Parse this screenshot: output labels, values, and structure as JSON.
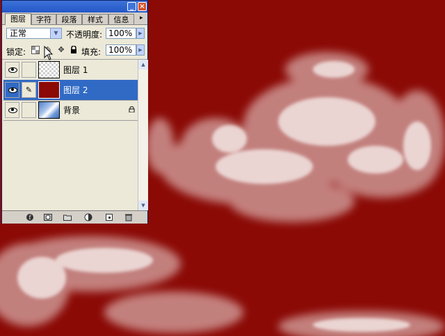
{
  "palette": {
    "tabs": [
      "图层",
      "字符",
      "段落",
      "样式",
      "信息"
    ],
    "window_min_label": "_",
    "window_close_label": "×",
    "tab_menu_glyph": "▸",
    "blend_mode": "正常",
    "opacity_label": "不透明度:",
    "opacity_value": "100%",
    "lock_label": "锁定:",
    "fill_label": "填充:",
    "fill_value": "100%"
  },
  "layers": [
    {
      "name": "图层 1",
      "selected": false,
      "thumb": "transparent"
    },
    {
      "name": "图层 2",
      "selected": true,
      "thumb": "red",
      "brush": "✎"
    },
    {
      "name": "背景",
      "selected": false,
      "thumb": "sky",
      "locked": true
    }
  ],
  "icons": {
    "blend_dropdown": "chevron-down-icon",
    "lock_transparent": "lock-transparent-icon",
    "lock_paint": "brush-icon",
    "lock_move": "move-icon",
    "lock_all": "lock-icon",
    "bottom": [
      "link-icon",
      "mask-icon",
      "folder-icon",
      "adjustment-icon",
      "new-layer-icon",
      "trash-icon"
    ]
  },
  "colors": {
    "canvas_bg": "#8b0a06",
    "selection": "#316ac5",
    "titlebar": "#2358c8"
  }
}
